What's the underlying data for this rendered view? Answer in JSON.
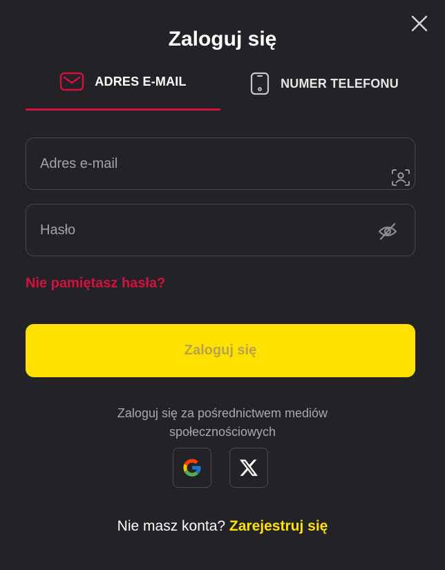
{
  "modal": {
    "title": "Zaloguj się",
    "close_icon": "close-icon"
  },
  "tabs": [
    {
      "label": "ADRES E-MAIL",
      "icon": "envelope-icon",
      "active": true
    },
    {
      "label": "NUMER TELEFONU",
      "icon": "phone-icon",
      "active": false
    }
  ],
  "form": {
    "email": {
      "value": "",
      "placeholder": "Adres e-mail",
      "icon": "user-scan-icon"
    },
    "password": {
      "value": "",
      "placeholder": "Hasło",
      "icon": "eye-off-icon"
    },
    "forgot_label": "Nie pamiętasz hasła?",
    "submit_label": "Zaloguj się"
  },
  "social": {
    "text": "Zaloguj się za pośrednictwem mediów społecznościowych",
    "providers": [
      {
        "name": "Google",
        "icon": "google-icon"
      },
      {
        "name": "X",
        "icon": "x-icon"
      }
    ]
  },
  "register": {
    "question": "Nie masz konta?",
    "link_label": "Zarejestruj się"
  },
  "colors": {
    "background": "#232327",
    "accent_red": "#d4113e",
    "accent_yellow": "#ffe100",
    "button_text": "#b8a34a"
  }
}
